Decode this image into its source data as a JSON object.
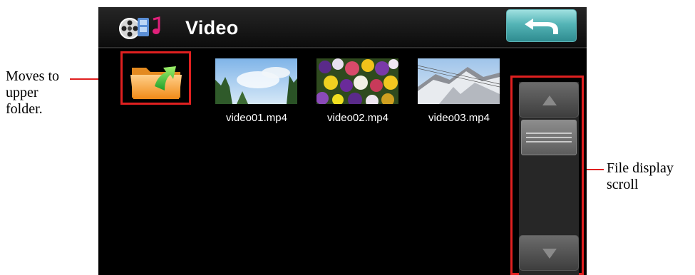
{
  "header": {
    "title": "Video",
    "app_icon": "film-music-icon",
    "back_icon": "return-arrow-icon"
  },
  "up_folder": {
    "icon": "folder-up-icon"
  },
  "files": [
    {
      "name": "video01.mp4",
      "thumb": "sky-trees"
    },
    {
      "name": "video02.mp4",
      "thumb": "pansy-flowers"
    },
    {
      "name": "video03.mp4",
      "thumb": "snowy-mountain"
    }
  ],
  "scrollbar": {
    "up_icon": "triangle-up-icon",
    "down_icon": "triangle-down-icon"
  },
  "annotations": {
    "upper_folder": [
      "Moves to",
      "upper",
      "folder."
    ],
    "scroll": [
      "File display",
      "scroll"
    ]
  },
  "colors": {
    "highlight": "#e02020",
    "back_button": "#54b4b6",
    "screen_bg": "#000000",
    "header_bg": "#1a1a1a"
  }
}
